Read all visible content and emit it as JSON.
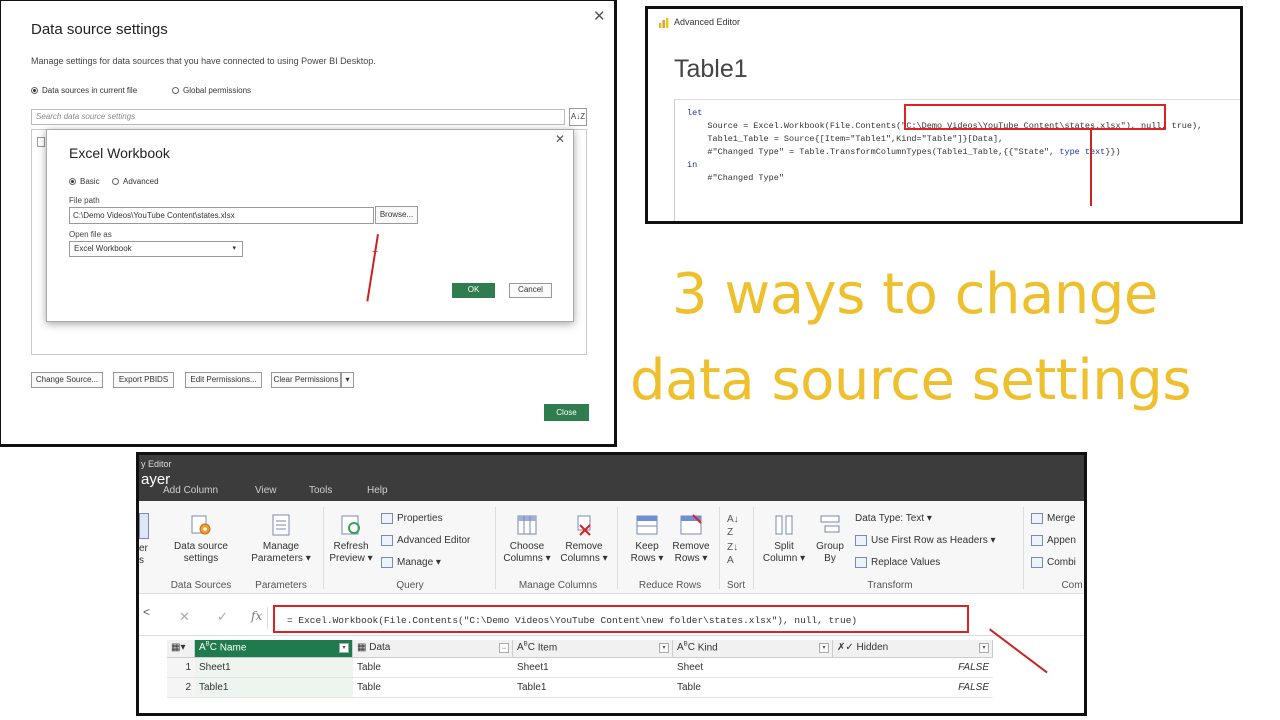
{
  "data_source_settings": {
    "title": "Data source settings",
    "close": "✕",
    "description": "Manage settings for data sources that you have connected to using Power BI Desktop.",
    "scope_options": [
      "Data sources in current file",
      "Global permissions"
    ],
    "selected_scope": "Data sources in current file",
    "search_placeholder": "Search data source settings",
    "sort_glyph": "A↓Z",
    "buttons": {
      "change_source": "Change Source...",
      "export_pbids": "Export PBIDS",
      "edit_permissions": "Edit Permissions...",
      "clear_permissions": "Clear Permissions",
      "close": "Close"
    },
    "excel_dialog": {
      "title": "Excel Workbook",
      "close": "✕",
      "modes": [
        "Basic",
        "Advanced"
      ],
      "selected_mode": "Basic",
      "file_path_label": "File path",
      "file_path_value": "C:\\Demo Videos\\YouTube Content\\states.xlsx",
      "browse": "Browse...",
      "open_as_label": "Open file as",
      "open_as_value": "Excel Workbook",
      "ok": "OK",
      "cancel": "Cancel"
    }
  },
  "advanced_editor": {
    "window_label": "Advanced Editor",
    "query_title": "Table1",
    "code": {
      "kw_let": "let",
      "line1_a": "    Source = Excel.Workbook(File.Contents(",
      "line1_path": "\"C:\\Demo Videos\\YouTube Content\\states.xlsx\"",
      "line1_b": "), null, true),",
      "line2": "    Table1_Table = Source{[Item=\"Table1\",Kind=\"Table\"]}[Data],",
      "line3_a": "    #\"Changed Type\" = Table.TransformColumnTypes(Table1_Table,{{\"State\", ",
      "line3_type": "type text",
      "line3_b": "}})",
      "kw_in": "in",
      "line5": "    #\"Changed Type\""
    }
  },
  "headline": {
    "line1": "3 ways to change",
    "line2": "data source settings",
    "color": "#efc02e"
  },
  "power_query": {
    "window_title": "y Editor",
    "window_subtitle": "ayer",
    "menu": [
      "Add Column",
      "View",
      "Tools",
      "Help"
    ],
    "ribbon": {
      "data_source_settings": "Data source\nsettings",
      "manage_parameters": "Manage\nParameters ▾",
      "refresh_preview": "Refresh\nPreview ▾",
      "properties": "Properties",
      "advanced_editor": "Advanced Editor",
      "manage": "Manage ▾",
      "choose_columns": "Choose\nColumns ▾",
      "remove_columns": "Remove\nColumns ▾",
      "keep_rows": "Keep\nRows ▾",
      "remove_rows": "Remove\nRows ▾",
      "split_column": "Split\nColumn ▾",
      "group_by": "Group\nBy",
      "data_type": "Data Type: Text ▾",
      "first_row_headers": "Use First Row as Headers ▾",
      "replace_values": "Replace Values",
      "merge": "Merge",
      "append": "Appen",
      "combine": "Combi",
      "left_edge": "er\ns",
      "groups": {
        "data_sources": "Data Sources",
        "parameters": "Parameters",
        "query": "Query",
        "manage_columns": "Manage Columns",
        "reduce_rows": "Reduce Rows",
        "sort": "Sort",
        "transform": "Transform",
        "combine": "Com"
      }
    },
    "formula": "= Excel.Workbook(File.Contents(\"C:\\Demo Videos\\YouTube Content\\new folder\\states.xlsx\"), null, true)",
    "formula_cancel": "✕",
    "formula_check": "✓",
    "formula_fx": "fx",
    "collapse": "<",
    "columns": [
      "Name",
      "Data",
      "Item",
      "Kind",
      "Hidden"
    ],
    "rows": [
      {
        "n": "1",
        "name": "Sheet1",
        "data": "Table",
        "item": "Sheet1",
        "kind": "Sheet",
        "hidden": "FALSE"
      },
      {
        "n": "2",
        "name": "Table1",
        "data": "Table",
        "item": "Table1",
        "kind": "Table",
        "hidden": "FALSE"
      }
    ]
  }
}
